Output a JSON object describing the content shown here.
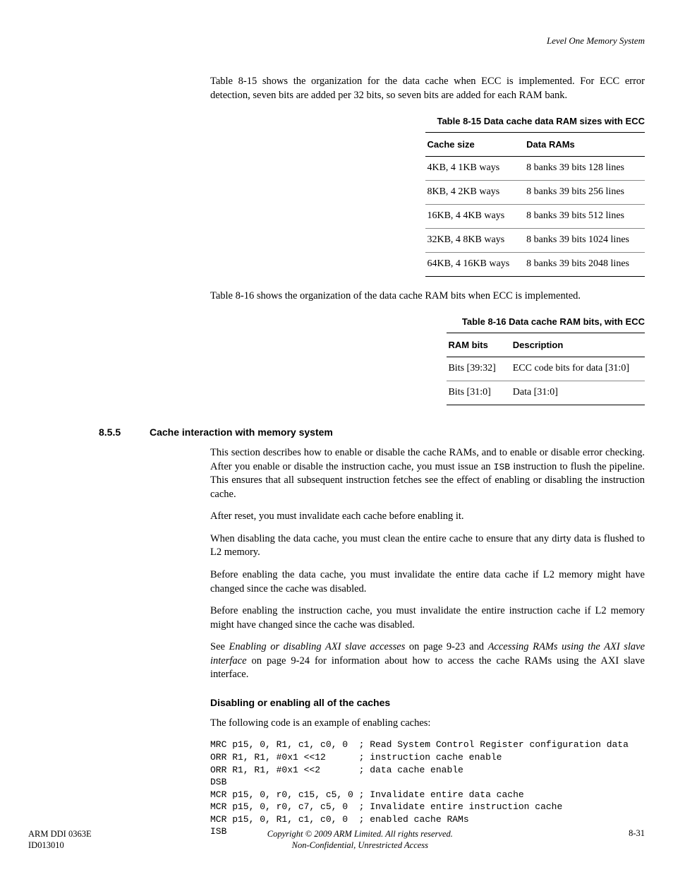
{
  "header": {
    "right": "Level One Memory System"
  },
  "intro_para": "Table 8-15 shows the organization for the data cache when ECC is implemented. For ECC error detection, seven bits are added per 32 bits, so seven bits are added for each RAM bank.",
  "table815": {
    "caption": "Table 8-15 Data cache data RAM sizes with ECC",
    "head": {
      "c1": "Cache size",
      "c2": "Data RAMs"
    },
    "rows": [
      {
        "c1": "4KB, 4 1KB ways",
        "c2": "8 banks 39 bits 128 lines"
      },
      {
        "c1": "8KB, 4 2KB ways",
        "c2": "8 banks 39 bits 256 lines"
      },
      {
        "c1": "16KB, 4 4KB ways",
        "c2": "8 banks 39 bits 512 lines"
      },
      {
        "c1": "32KB, 4 8KB ways",
        "c2": "8 banks 39 bits 1024 lines"
      },
      {
        "c1": "64KB, 4 16KB ways",
        "c2": "8 banks 39 bits 2048 lines"
      }
    ]
  },
  "mid_para": "Table 8-16 shows the organization of the data cache RAM bits when ECC is implemented.",
  "table816": {
    "caption": "Table 8-16 Data cache RAM bits, with ECC",
    "head": {
      "c1": "RAM bits",
      "c2": "Description"
    },
    "rows": [
      {
        "c1": "Bits [39:32]",
        "c2": "ECC code bits for data [31:0]"
      },
      {
        "c1": "Bits [31:0]",
        "c2": "Data [31:0]"
      }
    ]
  },
  "section": {
    "num": "8.5.5",
    "title": "Cache interaction with memory system"
  },
  "paras": {
    "p1a": "This section describes how to enable or disable the cache RAMs, and to enable or disable error checking. After you enable or disable the instruction cache, you must issue an ",
    "p1_isb": "ISB",
    "p1b": " instruction to flush the pipeline. This ensures that all subsequent instruction fetches see the effect of enabling or disabling the instruction cache.",
    "p2": "After reset, you must invalidate each cache before enabling it.",
    "p3": "When disabling the data cache, you must clean the entire cache to ensure that any dirty data is flushed to L2 memory.",
    "p4": "Before enabling the data cache, you must invalidate the entire data cache if L2 memory might have changed since the cache was disabled.",
    "p5": "Before enabling the instruction cache, you must invalidate the entire instruction cache if L2 memory might have changed since the cache was disabled.",
    "p6a": "See ",
    "p6_i1": "Enabling or disabling AXI slave accesses",
    "p6b": " on page 9-23 and ",
    "p6_i2": "Accessing RAMs using the AXI slave interface",
    "p6c": " on page 9-24 for information about how to access the cache RAMs using the AXI slave interface."
  },
  "subsection": {
    "title": "Disabling or enabling all of the caches",
    "intro": "The following code is an example of enabling caches:"
  },
  "code": "MRC p15, 0, R1, c1, c0, 0  ; Read System Control Register configuration data\nORR R1, R1, #0x1 <<12      ; instruction cache enable\nORR R1, R1, #0x1 <<2       ; data cache enable\nDSB\nMCR p15, 0, r0, c15, c5, 0 ; Invalidate entire data cache\nMCR p15, 0, r0, c7, c5, 0  ; Invalidate entire instruction cache\nMCR p15, 0, R1, c1, c0, 0  ; enabled cache RAMs\nISB",
  "footer": {
    "left1": "ARM DDI 0363E",
    "left2": "ID013010",
    "center1": "Copyright © 2009 ARM Limited. All rights reserved.",
    "center2": "Non-Confidential, Unrestricted Access",
    "right": "8-31"
  }
}
